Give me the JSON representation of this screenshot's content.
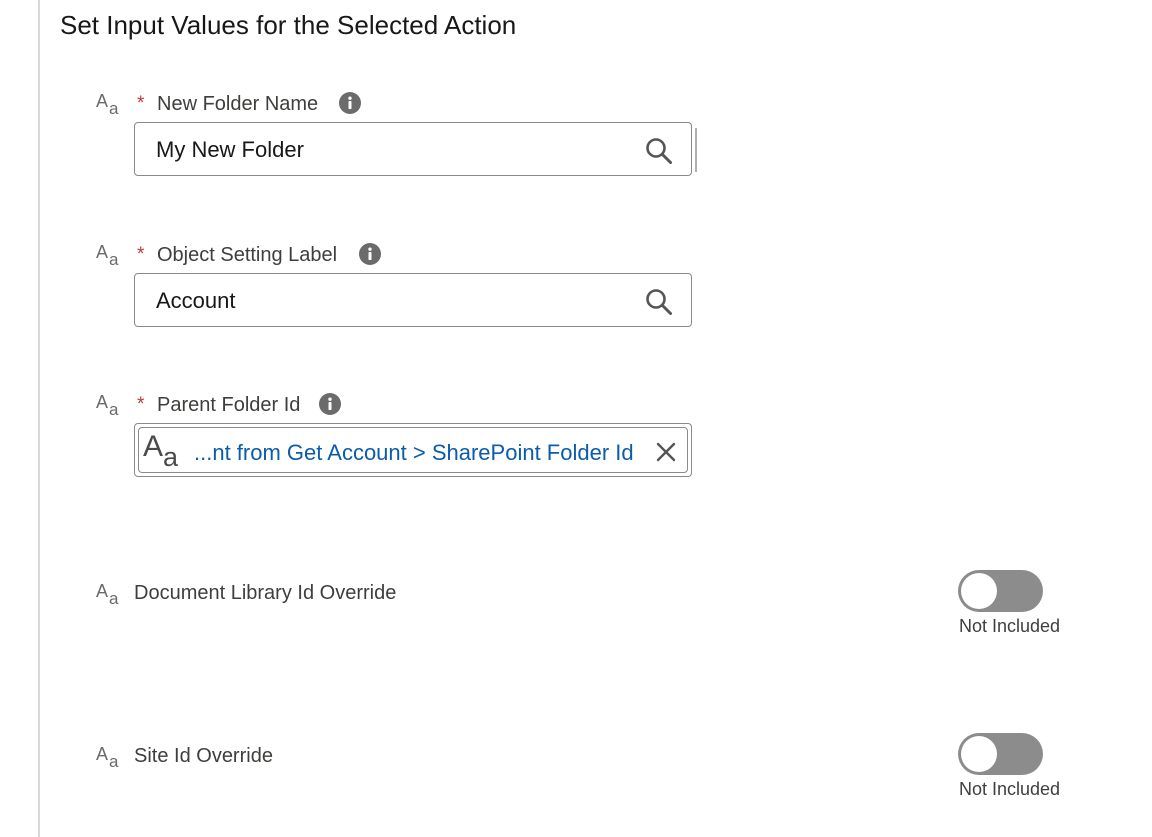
{
  "header": {
    "title": "Set Input Values for the Selected Action"
  },
  "fields": [
    {
      "label": "New Folder Name",
      "required": "*",
      "value": "My New Folder",
      "type_icon": "text-type-icon",
      "action_icon": "search-icon"
    },
    {
      "label": "Object Setting Label",
      "required": "*",
      "value": "Account",
      "type_icon": "text-type-icon",
      "action_icon": "search-icon"
    },
    {
      "label": "Parent Folder Id",
      "required": "*",
      "value": "...nt from Get Account > SharePoint Folder Id",
      "type_icon": "text-type-icon",
      "action_icon": "close-icon"
    }
  ],
  "optional_fields": [
    {
      "label": "Document Library Id Override",
      "toggle_state": "off",
      "toggle_caption": "Not Included"
    },
    {
      "label": "Site Id Override",
      "toggle_state": "off",
      "toggle_caption": "Not Included"
    }
  ],
  "type_glyph": {
    "upper": "A",
    "lower": "a"
  },
  "colors": {
    "required": "#c23934",
    "resource_link": "#0b5cab",
    "toggle_off": "#8c8c8c",
    "info_icon": "#6b6b6b"
  }
}
